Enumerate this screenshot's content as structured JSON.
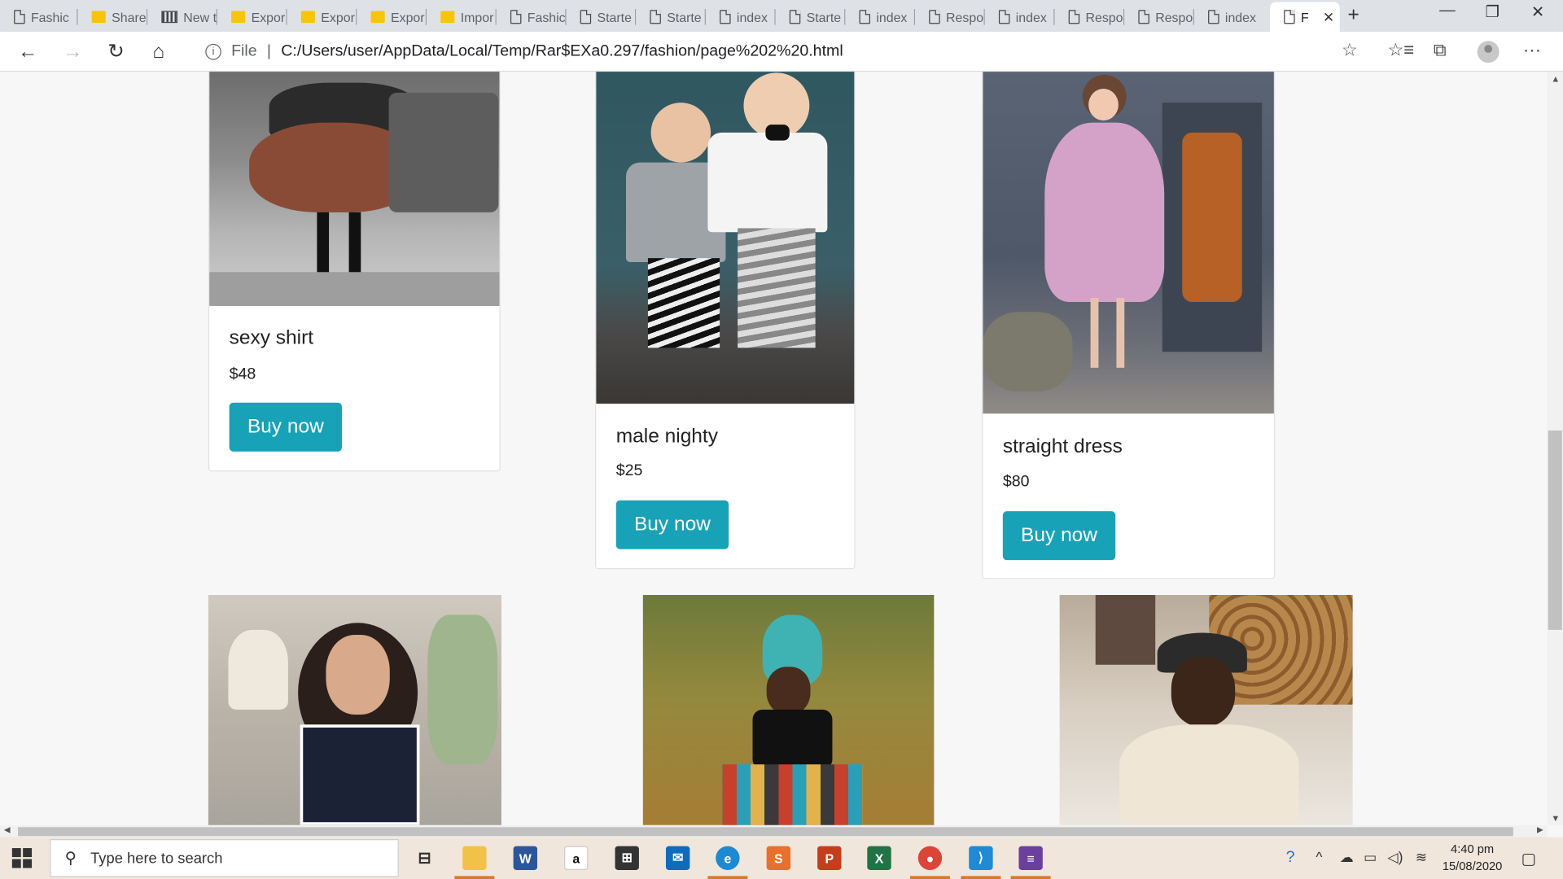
{
  "browser": {
    "tabs": [
      {
        "label": "Fashic",
        "icon": "page-icon"
      },
      {
        "label": "Share",
        "icon": "folder-icon"
      },
      {
        "label": "New t",
        "icon": "grid-icon"
      },
      {
        "label": "Expor",
        "icon": "folder-icon"
      },
      {
        "label": "Expor",
        "icon": "folder-icon"
      },
      {
        "label": "Expor",
        "icon": "folder-icon"
      },
      {
        "label": "Impor",
        "icon": "folder-icon"
      },
      {
        "label": "Fashic",
        "icon": "page-icon"
      },
      {
        "label": "Starte",
        "icon": "page-icon"
      },
      {
        "label": "Starte",
        "icon": "page-icon"
      },
      {
        "label": "index",
        "icon": "page-icon"
      },
      {
        "label": "Starte",
        "icon": "page-icon"
      },
      {
        "label": "index",
        "icon": "page-icon"
      },
      {
        "label": "Respo",
        "icon": "page-icon"
      },
      {
        "label": "index",
        "icon": "page-icon"
      },
      {
        "label": "Respo",
        "icon": "page-icon"
      },
      {
        "label": "Respo",
        "icon": "page-icon"
      },
      {
        "label": "index",
        "icon": "page-icon"
      },
      {
        "label": "F",
        "icon": "page-icon",
        "active": true
      }
    ],
    "address": {
      "scheme_label": "File",
      "url": "C:/Users/user/AppData/Local/Temp/Rar$EXa0.297/fashion/page%202%20.html"
    }
  },
  "products": [
    {
      "name": "sexy shirt",
      "price": "$48",
      "button": "Buy now"
    },
    {
      "name": "male nighty",
      "price": "$25",
      "button": "Buy now"
    },
    {
      "name": "straight dress",
      "price": "$80",
      "button": "Buy now"
    }
  ],
  "taskbar": {
    "search_placeholder": "Type here to search",
    "time": "4:40 pm",
    "date": "15/08/2020"
  },
  "colors": {
    "accent": "#17a2b8",
    "page_bg": "#f7f7f7",
    "taskbar_bg": "#f0e6dc"
  }
}
